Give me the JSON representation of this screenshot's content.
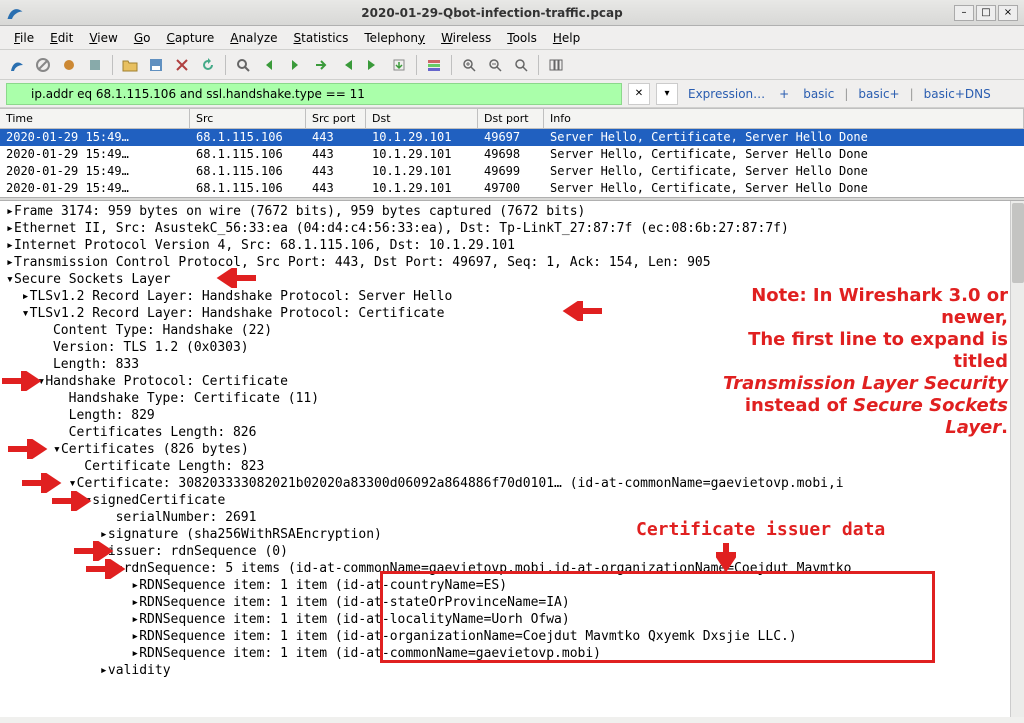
{
  "window": {
    "title": "2020-01-29-Qbot-infection-traffic.pcap"
  },
  "menu": {
    "items": [
      "File",
      "Edit",
      "View",
      "Go",
      "Capture",
      "Analyze",
      "Statistics",
      "Telephony",
      "Wireless",
      "Tools",
      "Help"
    ]
  },
  "filter": {
    "value": "ip.addr eq 68.1.115.106 and ssl.handshake.type == 11",
    "expression": "Expression…",
    "plus": "+",
    "presets": [
      "basic",
      "basic+",
      "basic+DNS"
    ]
  },
  "packet_columns": [
    "Time",
    "Src",
    "Src port",
    "Dst",
    "Dst port",
    "Info"
  ],
  "packets": [
    {
      "time": "2020-01-29 15:49…",
      "src": "68.1.115.106",
      "sport": "443",
      "dst": "10.1.29.101",
      "dport": "49697",
      "info": "Server Hello, Certificate, Server Hello Done",
      "selected": true
    },
    {
      "time": "2020-01-29 15:49…",
      "src": "68.1.115.106",
      "sport": "443",
      "dst": "10.1.29.101",
      "dport": "49698",
      "info": "Server Hello, Certificate, Server Hello Done"
    },
    {
      "time": "2020-01-29 15:49…",
      "src": "68.1.115.106",
      "sport": "443",
      "dst": "10.1.29.101",
      "dport": "49699",
      "info": "Server Hello, Certificate, Server Hello Done"
    },
    {
      "time": "2020-01-29 15:49…",
      "src": "68.1.115.106",
      "sport": "443",
      "dst": "10.1.29.101",
      "dport": "49700",
      "info": "Server Hello, Certificate, Server Hello Done"
    }
  ],
  "details": {
    "l0": "Frame 3174: 959 bytes on wire (7672 bits), 959 bytes captured (7672 bits)",
    "l1": "Ethernet II, Src: AsustekC_56:33:ea (04:d4:c4:56:33:ea), Dst: Tp-LinkT_27:87:7f (ec:08:6b:27:87:7f)",
    "l2": "Internet Protocol Version 4, Src: 68.1.115.106, Dst: 10.1.29.101",
    "l3": "Transmission Control Protocol, Src Port: 443, Dst Port: 49697, Seq: 1, Ack: 154, Len: 905",
    "l4": "Secure Sockets Layer",
    "l5": "TLSv1.2 Record Layer: Handshake Protocol: Server Hello",
    "l6": "TLSv1.2 Record Layer: Handshake Protocol: Certificate",
    "l7": "Content Type: Handshake (22)",
    "l8": "Version: TLS 1.2 (0x0303)",
    "l9": "Length: 833",
    "l10": "Handshake Protocol: Certificate",
    "l11": "Handshake Type: Certificate (11)",
    "l12": "Length: 829",
    "l13": "Certificates Length: 826",
    "l14": "Certificates (826 bytes)",
    "l15": "Certificate Length: 823",
    "l16": "Certificate: 308203333082021b02020a83300d06092a864886f70d0101… (id-at-commonName=gaevietovp.mobi,i",
    "l17": "signedCertificate",
    "l18": "serialNumber: 2691",
    "l19": "signature (sha256WithRSAEncryption)",
    "l20": "issuer: rdnSequence (0)",
    "l21": "rdnSequence: 5 items (id-at-commonName=gaevietovp.mobi,id-at-organizationName=Coejdut Mavmtko ",
    "l22": "RDNSequence item: 1 item (id-at-countryName=ES)",
    "l23": "RDNSequence item: 1 item (id-at-stateOrProvinceName=IA)",
    "l24": "RDNSequence item: 1 item (id-at-localityName=Uorh Ofwa)",
    "l25": "RDNSequence item: 1 item (id-at-organizationName=Coejdut Mavmtko Qxyemk Dxsjie LLC.)",
    "l26": "RDNSequence item: 1 item (id-at-commonName=gaevietovp.mobi)",
    "l27": "validity"
  },
  "annotations": {
    "note1": "Note: In Wireshark 3.0 or newer,",
    "note2": "The first line to expand is titled",
    "note3a": "Transmission Layer Security",
    "note4a": "instead of ",
    "note4b": "Secure Sockets Layer",
    "note4c": ".",
    "issuer_label": "Certificate issuer data"
  }
}
